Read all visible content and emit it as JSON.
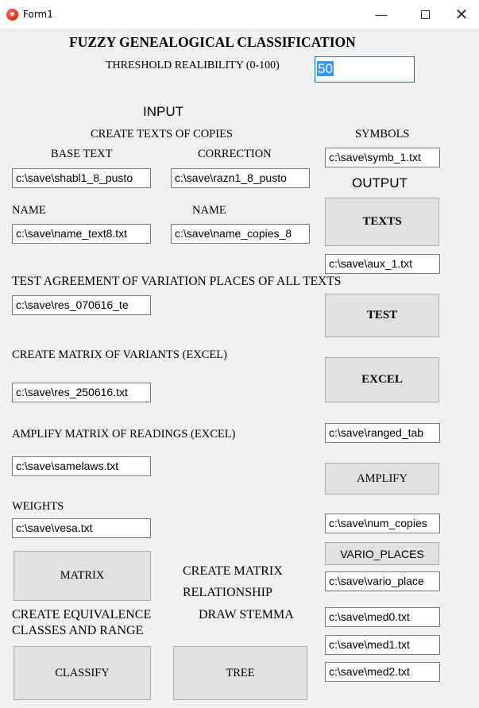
{
  "window": {
    "title": "Form1",
    "controls": {
      "minimize": "—",
      "close": "✕"
    }
  },
  "header": {
    "title": "FUZZY GENEALOGICAL CLASSIFICATION",
    "threshold_label": "THRESHOLD REALIBILITY (0-100)",
    "threshold_value": "50"
  },
  "input": {
    "heading": "INPUT",
    "create_texts_label": "CREATE TEXTS OF COPIES",
    "base_text_label": "BASE TEXT",
    "correction_label": "CORRECTION",
    "base_text_value": "c:\\save\\shabl1_8_pusto",
    "correction_value": "c:\\save\\razn1_8_pusto",
    "name_label_1": "NAME",
    "name_label_2": "NAME",
    "name_text_value": "c:\\save\\name_text8.txt",
    "name_copies_value": "c:\\save\\name_copies_8",
    "test_agreement_label": "TEST AGREEMENT OF VARIATION PLACES OF ALL TEXTS",
    "test_result_value": "c:\\save\\res_070616_te",
    "create_matrix_variants_label": "CREATE MATRIX OF VARIANTS (EXCEL)",
    "variants_result_value": "c:\\save\\res_250616.txt",
    "amplify_label": "AMPLIFY MATRIX OF READINGS (EXCEL)",
    "samelaws_value": "c:\\save\\samelaws.txt",
    "weights_label": "WEIGHTS",
    "weights_value": "c:\\save\\vesa.txt",
    "create_matrix_relationship_label_1": "CREATE MATRIX",
    "create_matrix_relationship_label_2": "RELATIONSHIP",
    "create_classes_label_1": "CREATE EQUIVALENCE",
    "create_classes_label_2": "CLASSES AND RANGE",
    "draw_stemma_label": "DRAW STEMMA"
  },
  "output": {
    "symbols_label": "SYMBOLS",
    "symbols_value": "c:\\save\\symb_1.txt",
    "heading": "OUTPUT",
    "aux_value": "c:\\save\\aux_1.txt",
    "ranged_value": "c:\\save\\ranged_tab",
    "num_copies_value": "c:\\save\\num_copies",
    "vario_places_value": "c:\\save\\vario_place",
    "med0_value": "c:\\save\\med0.txt",
    "med1_value": "c:\\save\\med1.txt",
    "med2_value": "c:\\save\\med2.txt"
  },
  "buttons": {
    "texts": "TEXTS",
    "test": "TEST",
    "excel": "EXCEL",
    "amplify": "AMPLIFY",
    "vario_places": "VARIO_PLACES",
    "matrix": "MATRIX",
    "classify": "CLASSIFY",
    "tree": "TREE"
  }
}
